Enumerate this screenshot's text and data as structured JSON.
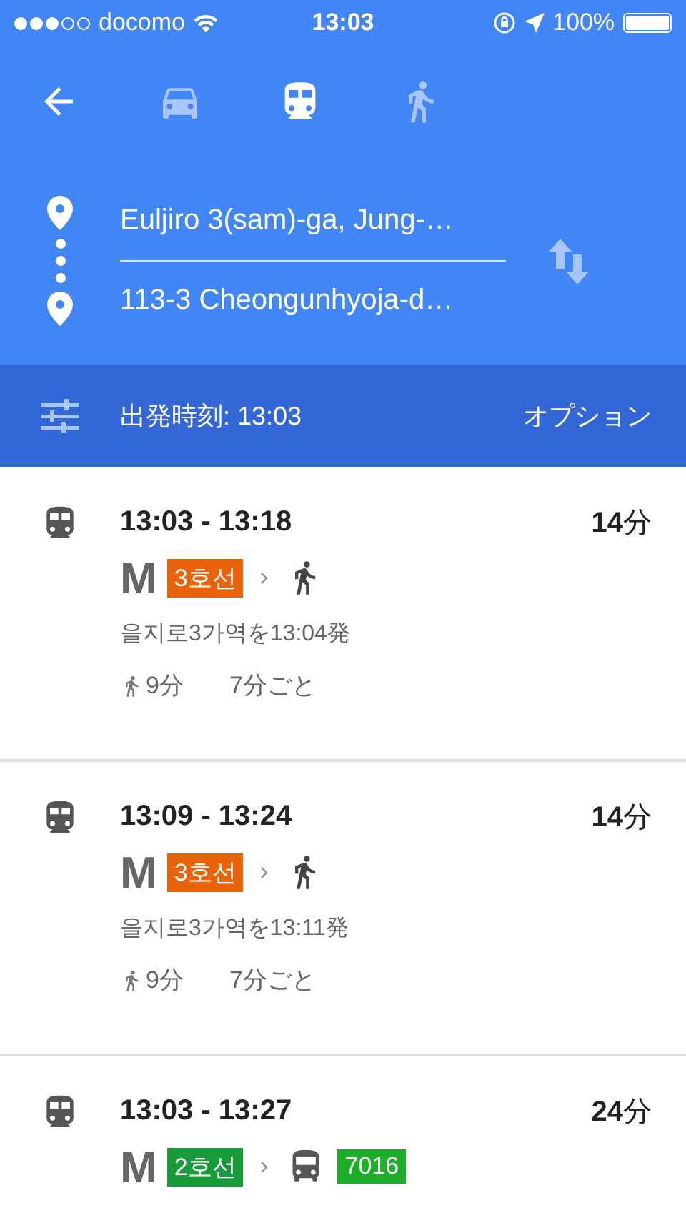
{
  "status_bar": {
    "carrier": "docomo",
    "time": "13:03",
    "battery": "100%"
  },
  "modes": [
    {
      "kind": "car",
      "selected": false
    },
    {
      "kind": "transit",
      "selected": true
    },
    {
      "kind": "walk",
      "selected": false
    }
  ],
  "route": {
    "origin": "Euljiro 3(sam)-ga, Jung-…",
    "destination": "113-3 Cheongunhyoja-d…"
  },
  "options_bar": {
    "departure": "出発時刻: 13:03",
    "options": "オプション"
  },
  "routes": [
    {
      "times": "13:03 - 13:18",
      "duration": "**14**分",
      "steps": [
        {
          "kind": "metro",
          "logo": "M",
          "line": "3호선",
          "color": "#e8630a"
        },
        {
          "kind": "walk"
        }
      ],
      "departure": "을지로3가역を13:04発",
      "walk": "9分",
      "frequency": "7分ごと"
    },
    {
      "times": "13:09 - 13:24",
      "duration": "**14**分",
      "steps": [
        {
          "kind": "metro",
          "logo": "M",
          "line": "3호선",
          "color": "#e8630a"
        },
        {
          "kind": "walk"
        }
      ],
      "departure": "을지로3가역を13:11発",
      "walk": "9分",
      "frequency": "7分ごと"
    },
    {
      "times": "13:03 - 13:27",
      "duration": "**24**分",
      "steps": [
        {
          "kind": "metro",
          "logo": "M",
          "line": "2호선",
          "color": "#1a9a3a"
        },
        {
          "kind": "bus",
          "line": "7016",
          "color": "#1fae2a"
        }
      ]
    }
  ]
}
